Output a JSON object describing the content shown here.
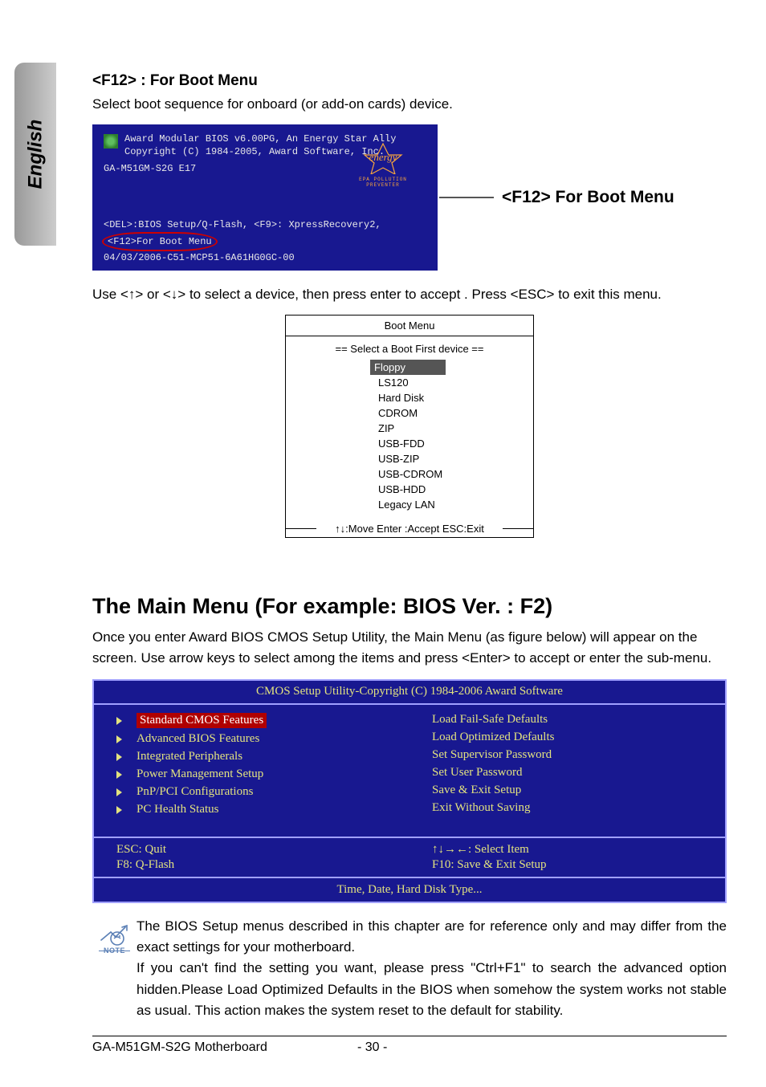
{
  "sideTab": "English",
  "section1": {
    "title": "<F12> : For Boot Menu",
    "intro": "Select boot sequence for onboard (or add-on cards) device.",
    "biosPost": {
      "line1": "Award Modular BIOS v6.00PG, An Energy Star Ally",
      "line2": "Copyright  (C) 1984-2005, Award Software,  Inc.",
      "board": "GA-M51GM-S2G E17",
      "energyStarSub": "EPA  POLLUTION  PREVENTER",
      "bottom_pre": "<DEL>:BIOS Setup/Q-Flash, <F9>: XpressRecovery2,",
      "bottom_highlight": "<F12>For Boot Menu",
      "bottom_date": "04/03/2006-C51-MCP51-6A61HG0GC-00"
    },
    "callout": "<F12> For Boot Menu",
    "afterBoot": "Use <↑> or <↓> to select a device, then press enter to accept . Press <ESC> to exit this menu.",
    "bootMenu": {
      "title": "Boot Menu",
      "subtitle": "==  Select a Boot First device  ==",
      "items": [
        "Floppy",
        "LS120",
        "Hard Disk",
        "CDROM",
        "ZIP",
        "USB-FDD",
        "USB-ZIP",
        "USB-CDROM",
        "USB-HDD",
        "Legacy LAN"
      ],
      "selectedIndex": 0,
      "hint": "↑↓:Move   Enter :Accept   ESC:Exit"
    }
  },
  "section2": {
    "heading": "The Main Menu (For example: BIOS Ver. : F2)",
    "intro": "Once you enter Award BIOS CMOS Setup Utility, the Main Menu (as figure below) will appear on the screen. Use arrow keys to select among the items and press <Enter> to accept or enter the sub-menu.",
    "cmos": {
      "title": "CMOS Setup Utility-Copyright (C) 1984-2006 Award Software",
      "left": [
        "Standard CMOS Features",
        "Advanced BIOS Features",
        "Integrated Peripherals",
        "Power Management Setup",
        "PnP/PCI Configurations",
        "PC Health Status"
      ],
      "right": [
        "Load Fail-Safe Defaults",
        "Load Optimized Defaults",
        "Set Supervisor Password",
        "Set User Password",
        "Save & Exit Setup",
        "Exit Without Saving"
      ],
      "footer": {
        "l1": "ESC: Quit",
        "l2": "F8:  Q-Flash",
        "r1": "↑↓→←: Select Item",
        "r2": "F10: Save & Exit Setup"
      },
      "bottom": "Time, Date, Hard Disk Type..."
    },
    "noteLabel": "NOTE",
    "note": "The BIOS Setup menus described in this chapter are for reference only and may differ from the exact settings for your motherboard.\nIf you can't find the setting you want, please press \"Ctrl+F1\" to search the advanced option hidden.Please Load Optimized Defaults in the BIOS when somehow the system works not stable as usual. This action makes the system reset to the default for stability."
  },
  "footer": {
    "left": "GA-M51GM-S2G Motherboard",
    "center": "- 30 -"
  }
}
